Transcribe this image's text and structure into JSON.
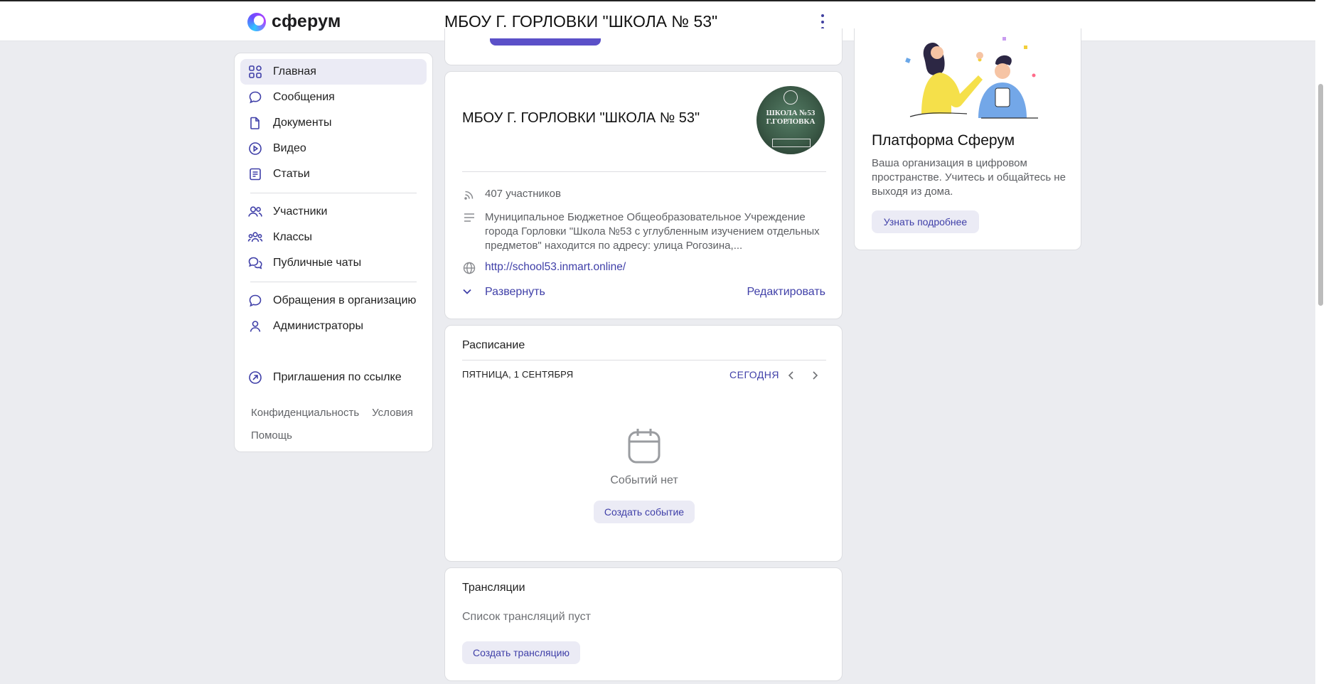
{
  "header": {
    "logo_text": "сферум",
    "org_title": "МБОУ Г. ГОРЛОВКИ \"ШКОЛА № 53\""
  },
  "sidebar": {
    "items": [
      {
        "label": "Главная",
        "icon": "grid-icon",
        "active": true
      },
      {
        "label": "Сообщения",
        "icon": "message-bubble-icon"
      },
      {
        "label": "Документы",
        "icon": "document-icon"
      },
      {
        "label": "Видео",
        "icon": "play-circle-icon"
      },
      {
        "label": "Статьи",
        "icon": "article-icon"
      },
      {
        "label": "Участники",
        "icon": "users-icon"
      },
      {
        "label": "Классы",
        "icon": "classes-icon"
      },
      {
        "label": "Публичные чаты",
        "icon": "chats-icon"
      },
      {
        "label": "Обращения в организацию",
        "icon": "appeal-bubble-icon"
      },
      {
        "label": "Администраторы",
        "icon": "admin-user-icon"
      },
      {
        "label": "Приглашения по ссылке",
        "icon": "invite-link-icon"
      }
    ],
    "footer": {
      "privacy": "Конфиденциальность",
      "terms": "Условия",
      "help": "Помощь"
    }
  },
  "org_card": {
    "title": "МБОУ Г. ГОРЛОВКИ \"ШКОЛА № 53\"",
    "logo_text": "ШКОЛА №53 Г.ГОРЛОВКА",
    "members": "407 участников",
    "description": "Муниципальное Бюджетное Общеобразовательное Учреждение города Горловки \"Школа №53 с углубленным изучением отдельных предметов\" находится по адресу: улица Рогозина,...",
    "website": "http://school53.inmart.online/",
    "expand_label": "Развернуть",
    "edit_label": "Редактировать"
  },
  "schedule": {
    "title": "Расписание",
    "date": "ПЯТНИЦА, 1 СЕНТЯБРЯ",
    "today_label": "СЕГОДНЯ",
    "empty_text": "Событий нет",
    "create_label": "Создать событие"
  },
  "broadcasts": {
    "title": "Трансляции",
    "empty_text": "Список трансляций пуст",
    "create_label": "Создать трансляцию"
  },
  "promo": {
    "title": "Платформа Сферум",
    "text": "Ваша организация в цифровом пространстве. Учитесь и общайтесь не выходя из дома.",
    "button_label": "Узнать подробнее"
  },
  "colors": {
    "accent": "#3f3fa8",
    "background": "#ebecf0",
    "active_nav": "#ebebf5"
  }
}
